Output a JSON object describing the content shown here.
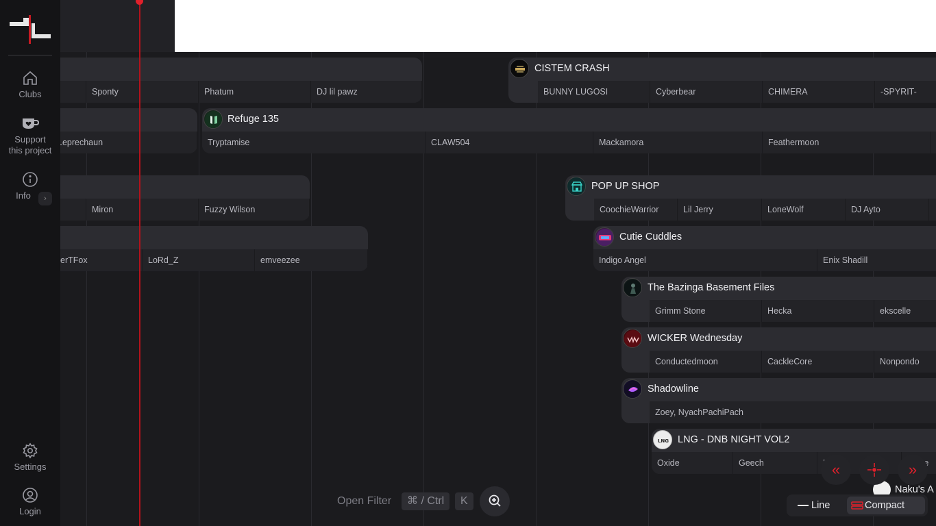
{
  "sidebar": {
    "nav": [
      {
        "label": "Clubs",
        "icon": "home-icon"
      },
      {
        "label": "Support this project",
        "line1": "Support",
        "line2": "this project",
        "icon": "coffee-heart-icon"
      },
      {
        "label": "Info",
        "icon": "info-icon"
      }
    ],
    "settings_label": "Settings",
    "login_label": "Login"
  },
  "events": [
    {
      "title": "",
      "slots": [
        "",
        "Sponty",
        "Phatum",
        "DJ lil pawz"
      ]
    },
    {
      "title": "CISTEM CRASH",
      "slots": [
        "BUNNY LUGOSI",
        "Cyberbear",
        "CHIMERA",
        "-SPYRIT-"
      ]
    },
    {
      "title": "",
      "slots": [
        "Leprechaun"
      ]
    },
    {
      "title": "Refuge 135",
      "slots": [
        "Tryptamise",
        "CLAW504",
        "Mackamora",
        "Feathermoon"
      ]
    },
    {
      "title": "",
      "slots": [
        "",
        "Miron",
        "Fuzzy Wilson"
      ]
    },
    {
      "title": "POP UP SHOP",
      "slots": [
        "CoochieWarrior",
        "Lil Jerry",
        "LoneWolf",
        "DJ Ayto"
      ]
    },
    {
      "title": "",
      "slots": [
        "erTFox",
        "LoRd_Z",
        "emveezee"
      ]
    },
    {
      "title": "Cutie Cuddles",
      "slots": [
        "Indigo Angel",
        "Enix Shadill"
      ]
    },
    {
      "title": "The Bazinga Basement Files",
      "slots": [
        "Grimm Stone",
        "Hecka",
        "ekscelle"
      ]
    },
    {
      "title": "WICKER Wednesday",
      "slots": [
        "Conductedmoon",
        "CackleCore",
        "Nonpondo"
      ]
    },
    {
      "title": "Shadowline",
      "slots": [
        "Zoey, NyachPachiPach"
      ]
    },
    {
      "title": "LNG - DNB NIGHT VOL2",
      "slots": [
        "Oxide",
        "Geech",
        "U...op",
        "...une"
      ]
    }
  ],
  "naku_label": "Naku's A",
  "bottom": {
    "filter_label": "Open Filter",
    "shortcut_mod": "⌘ / Ctrl",
    "shortcut_key": "K"
  },
  "view_toggle": {
    "line_label": "Line",
    "compact_label": "Compact",
    "active": "Compact"
  },
  "colors": {
    "accent": "#e0202b",
    "now_line": "#b3121b",
    "block": "#2c2c31",
    "slot": "#232327",
    "sidebar": "#141416"
  }
}
